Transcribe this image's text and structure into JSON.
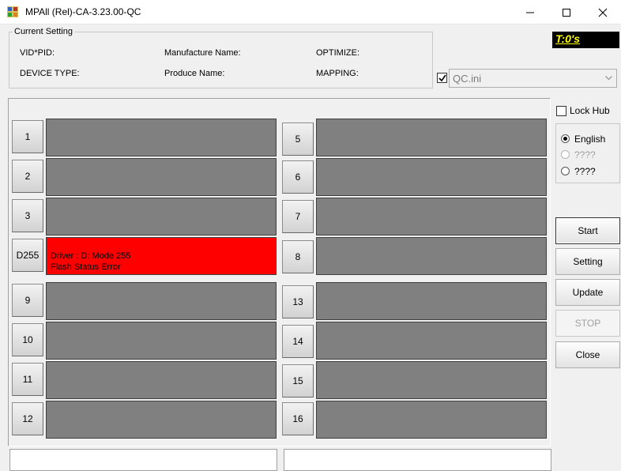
{
  "window": {
    "title": "MPAll (Rel)-CA-3.23.00-QC"
  },
  "current_setting": {
    "legend": "Current Setting",
    "vid_pid_label": "VID*PID:",
    "manufacture_name_label": "Manufacture Name:",
    "optimize_label": "OPTIMIZE:",
    "device_type_label": "DEVICE TYPE:",
    "produce_name_label": "Produce Name:",
    "mapping_label": "MAPPING:"
  },
  "timer": {
    "text": "T:0's",
    "color": "#ffff00",
    "background": "#000000"
  },
  "config": {
    "enabled": true,
    "file": "QC.ini"
  },
  "lock_hub": {
    "label": "Lock Hub",
    "checked": false
  },
  "language": {
    "options": [
      {
        "label": "English",
        "selected": true,
        "enabled": true
      },
      {
        "label": "????",
        "selected": false,
        "enabled": false
      },
      {
        "label": "????",
        "selected": false,
        "enabled": true
      }
    ]
  },
  "buttons": {
    "start": "Start",
    "setting": "Setting",
    "update": "Update",
    "stop": "STOP",
    "close": "Close"
  },
  "ports": [
    {
      "label": "1",
      "line1": "",
      "line2": "",
      "state": "idle"
    },
    {
      "label": "2",
      "line1": "",
      "line2": "",
      "state": "idle"
    },
    {
      "label": "3",
      "line1": "",
      "line2": "",
      "state": "idle"
    },
    {
      "label": "D255",
      "line1": "Driver : D: Mode 255",
      "line2": "Flash Status Error",
      "state": "error"
    },
    {
      "label": "9",
      "line1": "",
      "line2": "",
      "state": "idle"
    },
    {
      "label": "10",
      "line1": "",
      "line2": "",
      "state": "idle"
    },
    {
      "label": "11",
      "line1": "",
      "line2": "",
      "state": "idle"
    },
    {
      "label": "12",
      "line1": "",
      "line2": "",
      "state": "idle"
    },
    {
      "label": "5",
      "line1": "",
      "line2": "",
      "state": "idle"
    },
    {
      "label": "6",
      "line1": "",
      "line2": "",
      "state": "idle"
    },
    {
      "label": "7",
      "line1": "",
      "line2": "",
      "state": "idle"
    },
    {
      "label": "8",
      "line1": "",
      "line2": "",
      "state": "idle"
    },
    {
      "label": "13",
      "line1": "",
      "line2": "",
      "state": "idle"
    },
    {
      "label": "14",
      "line1": "",
      "line2": "",
      "state": "idle"
    },
    {
      "label": "15",
      "line1": "",
      "line2": "",
      "state": "idle"
    },
    {
      "label": "16",
      "line1": "",
      "line2": "",
      "state": "idle"
    }
  ],
  "colors": {
    "idle_status": "#808080",
    "error_status": "#ff0000"
  }
}
